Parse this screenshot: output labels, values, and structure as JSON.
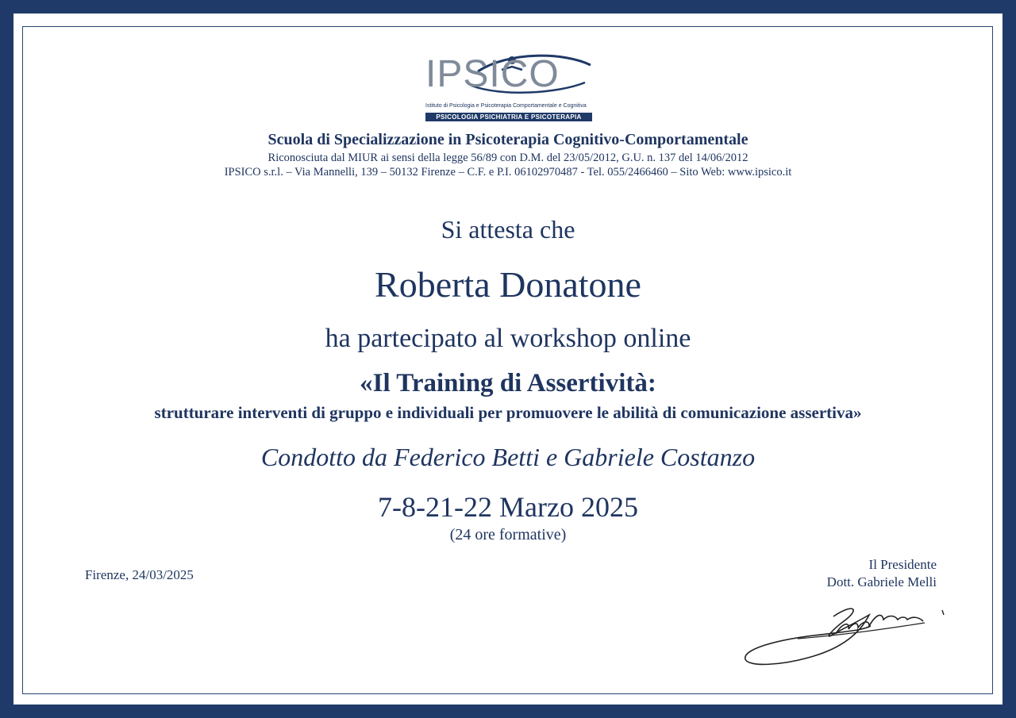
{
  "logo": {
    "wordmark": "IPSICO",
    "subtitle": "Istituto di Psicologia e Psicoterapia Comportamentale e Cognitiva",
    "band": "PSICOLOGIA  PSICHIATRIA E PSICOTERAPIA"
  },
  "header": {
    "school": "Scuola di Specializzazione in Psicoterapia Cognitivo-Comportamentale",
    "recognition": "Riconosciuta dal MIUR ai sensi della legge 56/89 con D.M. del 23/05/2012, G.U. n. 137 del 14/06/2012",
    "contacts": "IPSICO s.r.l. – Via Mannelli, 139 – 50132 Firenze – C.F. e P.I. 06102970487 - Tel. 055/2466460 – Sito Web: www.ipsico.it"
  },
  "body": {
    "attesta": "Si attesta che",
    "name": "Roberta Donatone",
    "participation": "ha partecipato al workshop online",
    "title": "«Il Training di Assertività:",
    "subtitle": "strutturare interventi di gruppo e individuali per promuovere le abilità di comunicazione assertiva»",
    "conductors": "Condotto da Federico Betti e Gabriele Costanzo",
    "dates": "7-8-21-22 Marzo 2025",
    "hours": "(24 ore formative)"
  },
  "footer": {
    "place_date": "Firenze, 24/03/2025",
    "role": "Il Presidente",
    "signatory": "Dott. Gabriele Melli"
  },
  "colors": {
    "frame": "#1f3a68",
    "text": "#1f3560",
    "logo_grey": "#7f8a9a"
  }
}
